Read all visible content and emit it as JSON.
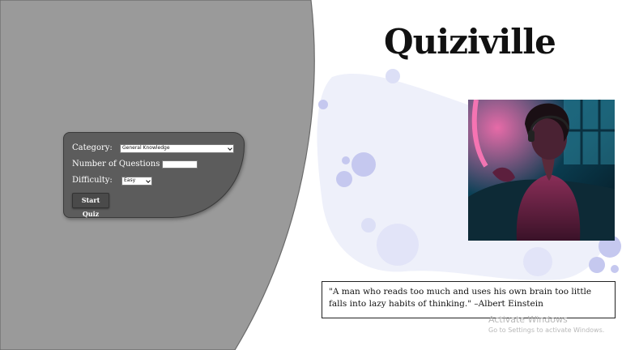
{
  "app": {
    "title": "Quiziville"
  },
  "quiz_form": {
    "category_label": "Category:",
    "category_value": "General Knowledge",
    "number_label": "Number of Questions",
    "number_value": "",
    "difficulty_label": "Difficulty:",
    "difficulty_value": "Easy",
    "start_button": "Start Quiz"
  },
  "quote": {
    "text": "\"A man who reads too much and uses his own brain too little falls into lazy habits of  thinking.\" –Albert Einstein"
  },
  "os_watermark": {
    "title": "Activate Windows",
    "subtitle": "Go to Settings to activate Windows."
  },
  "colors": {
    "left_panel": "#9a9a9a",
    "form_panel": "#5c5c5c",
    "blob": "#eef0fa",
    "bubble": "#c5c8ef"
  },
  "icons": {
    "dropdown": "chevron-down-icon"
  }
}
